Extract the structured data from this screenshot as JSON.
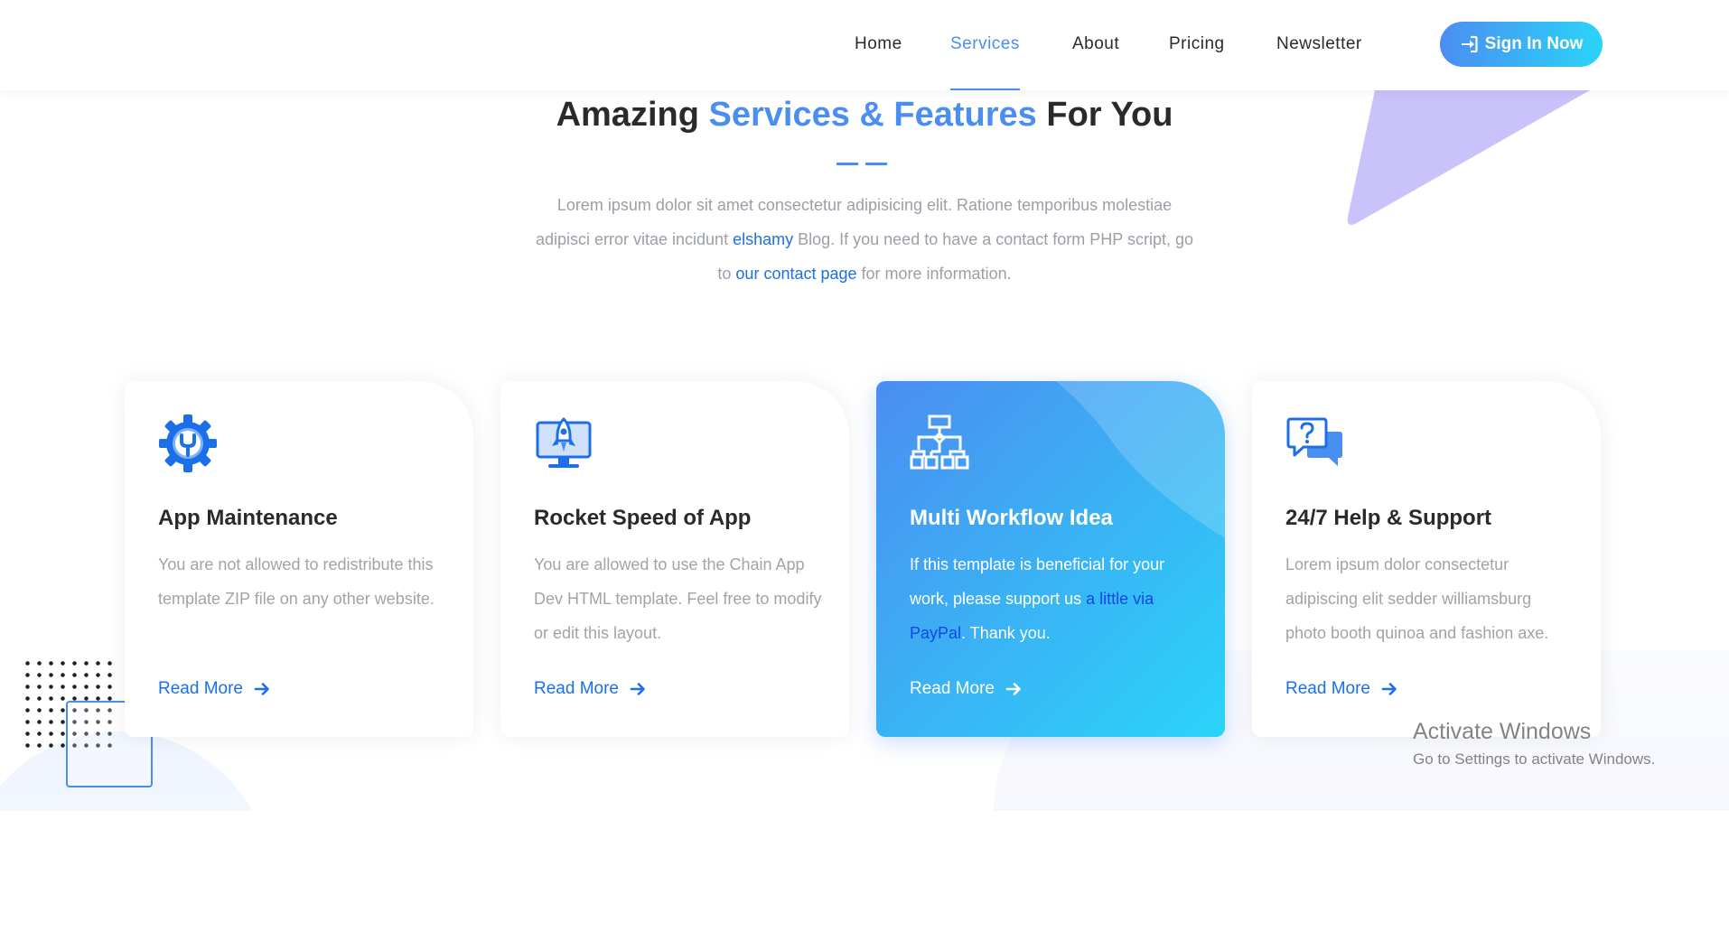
{
  "nav": {
    "items": [
      {
        "label": "Home",
        "active": false
      },
      {
        "label": "Services",
        "active": true
      },
      {
        "label": "About",
        "active": false
      },
      {
        "label": "Pricing",
        "active": false
      },
      {
        "label": "Newsletter",
        "active": false
      }
    ],
    "signin_label": "Sign In Now"
  },
  "section": {
    "title_pre": "Amazing ",
    "title_accent": "Services & Features",
    "title_post": " For You",
    "intro_1": "Lorem ipsum dolor sit amet consectetur adipisicing elit. Ratione temporibus molestiae adipisci error vitae incidunt ",
    "intro_link_1": "elshamy",
    "intro_2": " Blog. If you need to have a contact form PHP script, go to ",
    "intro_link_2": "our contact page",
    "intro_3": " for more information."
  },
  "cards": [
    {
      "icon": "gear-wrench-icon",
      "title": "App Maintenance",
      "text": "You are not allowed to redistribute this template ZIP file on any other website.",
      "read_more": "Read More"
    },
    {
      "icon": "rocket-monitor-icon",
      "title": "Rocket Speed of App",
      "text": "You are allowed to use the Chain App Dev HTML template. Feel free to modify or edit this layout.",
      "read_more": "Read More"
    },
    {
      "icon": "workflow-diagram-icon",
      "title": "Multi Workflow Idea",
      "text_1": "If this template is beneficial for your work, please support us ",
      "text_link": "a little via PayPal",
      "text_2": ". Thank you.",
      "read_more": "Read More"
    },
    {
      "icon": "help-chat-icon",
      "title": "24/7 Help & Support",
      "text": "Lorem ipsum dolor consectetur adipiscing elit sedder williamsburg photo booth quinoa and fashion axe.",
      "read_more": "Read More"
    }
  ],
  "watermark": {
    "title": "Activate Windows",
    "subtitle": "Go to Settings to activate Windows."
  },
  "colors": {
    "accent": "#4b8ef1",
    "accent_end": "#2ad4f8",
    "link": "#1c6fe8",
    "triangle": "#c9c2fb"
  }
}
